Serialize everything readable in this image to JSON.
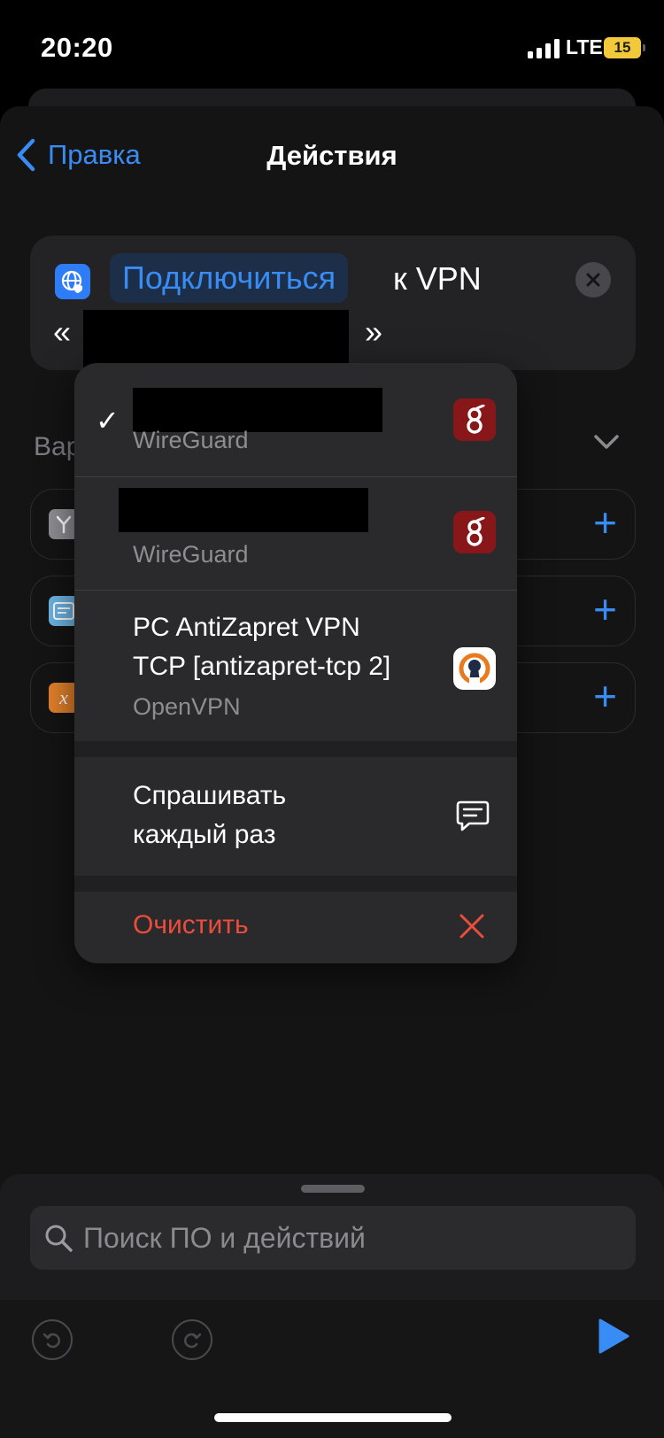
{
  "status_bar": {
    "time": "20:20",
    "network": "LTE",
    "battery": "15"
  },
  "nav": {
    "back_label": "Правка",
    "title": "Действия"
  },
  "action": {
    "verb": "Подключиться",
    "suffix": "к VPN",
    "quote_open": "«",
    "quote_close": "»"
  },
  "section": {
    "label": "Вар"
  },
  "vpn_menu": {
    "items": [
      {
        "title": "",
        "subtitle": "WireGuard",
        "selected": true,
        "icon": "wireguard-icon"
      },
      {
        "title": "",
        "subtitle": "WireGuard",
        "selected": false,
        "icon": "wireguard-icon"
      },
      {
        "title_line1": "PC AntiZapret VPN",
        "title_line2": "TCP [antizapret-tcp 2]",
        "subtitle": "OpenVPN",
        "icon": "openvpn-icon"
      }
    ],
    "ask_line1": "Спрашивать",
    "ask_line2": "каждый раз",
    "clear_label": "Очистить",
    "check_mark": "✓"
  },
  "search": {
    "placeholder": "Поиск ПО и действий"
  },
  "colors": {
    "accent": "#3a8cf5",
    "destructive": "#eb4d3d",
    "wireguard": "#88171a",
    "openvpn": "#ea7a1f"
  }
}
